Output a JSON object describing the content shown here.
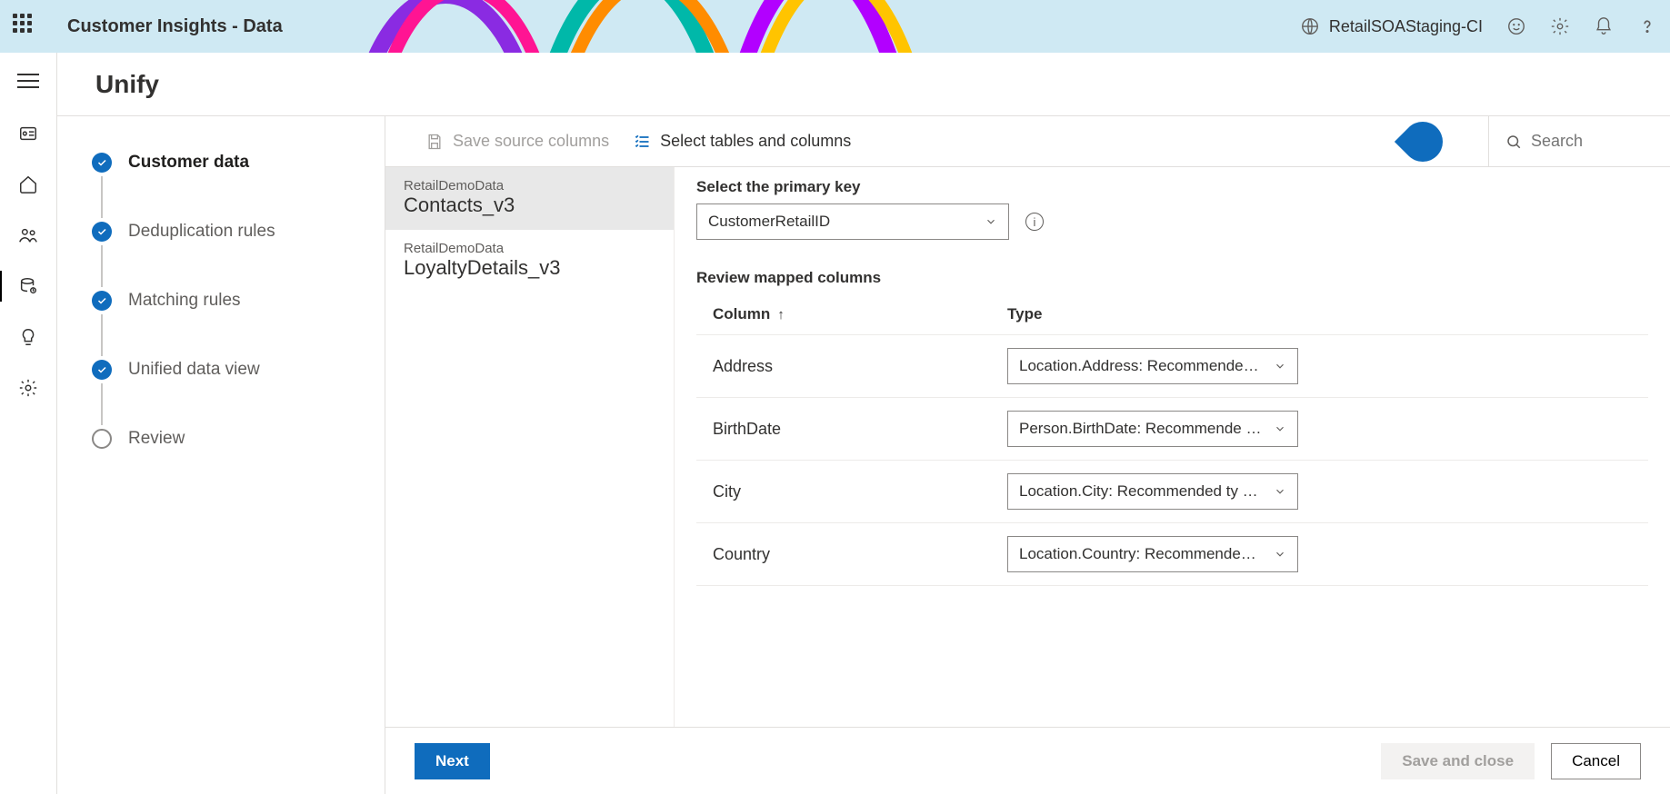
{
  "header": {
    "app_title": "Customer Insights - Data",
    "environment": "RetailSOAStaging-CI"
  },
  "page": {
    "title": "Unify"
  },
  "wizard": {
    "steps": [
      {
        "label": "Customer data",
        "state": "done",
        "current": true
      },
      {
        "label": "Deduplication rules",
        "state": "done",
        "current": false
      },
      {
        "label": "Matching rules",
        "state": "done",
        "current": false
      },
      {
        "label": "Unified data view",
        "state": "done",
        "current": false
      },
      {
        "label": "Review",
        "state": "pending",
        "current": false
      }
    ]
  },
  "toolbar": {
    "save_source_label": "Save source columns",
    "select_tables_label": "Select tables and columns",
    "search_placeholder": "Search"
  },
  "tables": [
    {
      "source": "RetailDemoData",
      "name": "Contacts_v3",
      "selected": true
    },
    {
      "source": "RetailDemoData",
      "name": "LoyaltyDetails_v3",
      "selected": false
    }
  ],
  "detail": {
    "pk_label": "Select the primary key",
    "pk_value": "CustomerRetailID",
    "review_label": "Review mapped columns",
    "col_header_column": "Column",
    "col_header_type": "Type",
    "rows": [
      {
        "column": "Address",
        "type": "Location.Address: Recommende…"
      },
      {
        "column": "BirthDate",
        "type": "Person.BirthDate: Recommende …"
      },
      {
        "column": "City",
        "type": "Location.City: Recommended ty …"
      },
      {
        "column": "Country",
        "type": "Location.Country: Recommende…"
      }
    ]
  },
  "footer": {
    "next": "Next",
    "save_close": "Save and close",
    "cancel": "Cancel"
  }
}
